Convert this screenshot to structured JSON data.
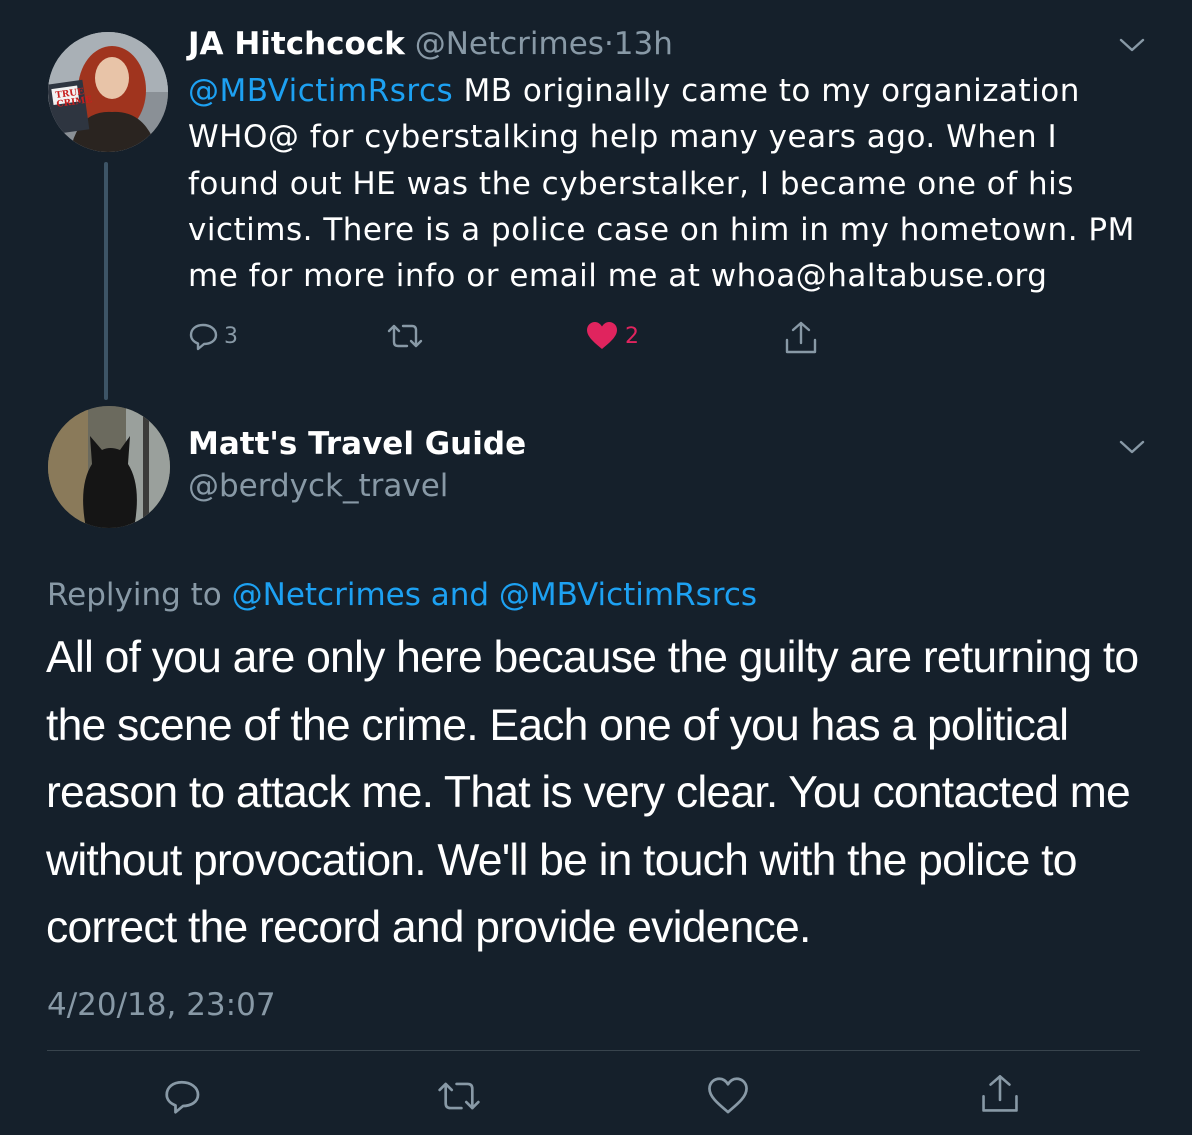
{
  "parent_tweet": {
    "author_name": "JA Hitchcock",
    "author_handle": "@Netcrimes",
    "separator": "·",
    "time": "13h",
    "avatar_book_text": "TRUE CRIME",
    "text_mention": "@MBVictimRsrcs",
    "text": " MB originally came to my organization WHO@ for cyberstalking help many years ago. When I found out HE was the cyberstalker, I became one of his victims. There is a police case on him in my hometown. PM me for  more info or email me at whoa@haltabuse.org",
    "reply_count": "3",
    "like_count": "2",
    "icons": [
      "chevron-down-icon",
      "reply-icon",
      "retweet-icon",
      "heart-filled-icon",
      "share-icon"
    ],
    "like_color": "#e0245e"
  },
  "main_tweet": {
    "author_name": "Matt's Travel Guide",
    "author_handle": "@berdyck_travel",
    "replying_label": "Replying to",
    "replying_mentions": "@Netcrimes and @MBVictimRsrcs",
    "text": "All of you are only here because the guilty are returning to the scene of the crime.  Each one of you has a political reason to attack me.  That is very clear.  You contacted me without provocation. We'll be in touch with the police to correct the record and provide evidence.",
    "timestamp": "4/20/18, 23:07",
    "icons": [
      "chevron-down-icon",
      "reply-icon",
      "retweet-icon",
      "heart-outline-icon",
      "share-icon"
    ]
  },
  "colors": {
    "background": "#15202b",
    "accent_link": "#1da1f2",
    "secondary_text": "#8899a6",
    "divider": "#38444d"
  }
}
